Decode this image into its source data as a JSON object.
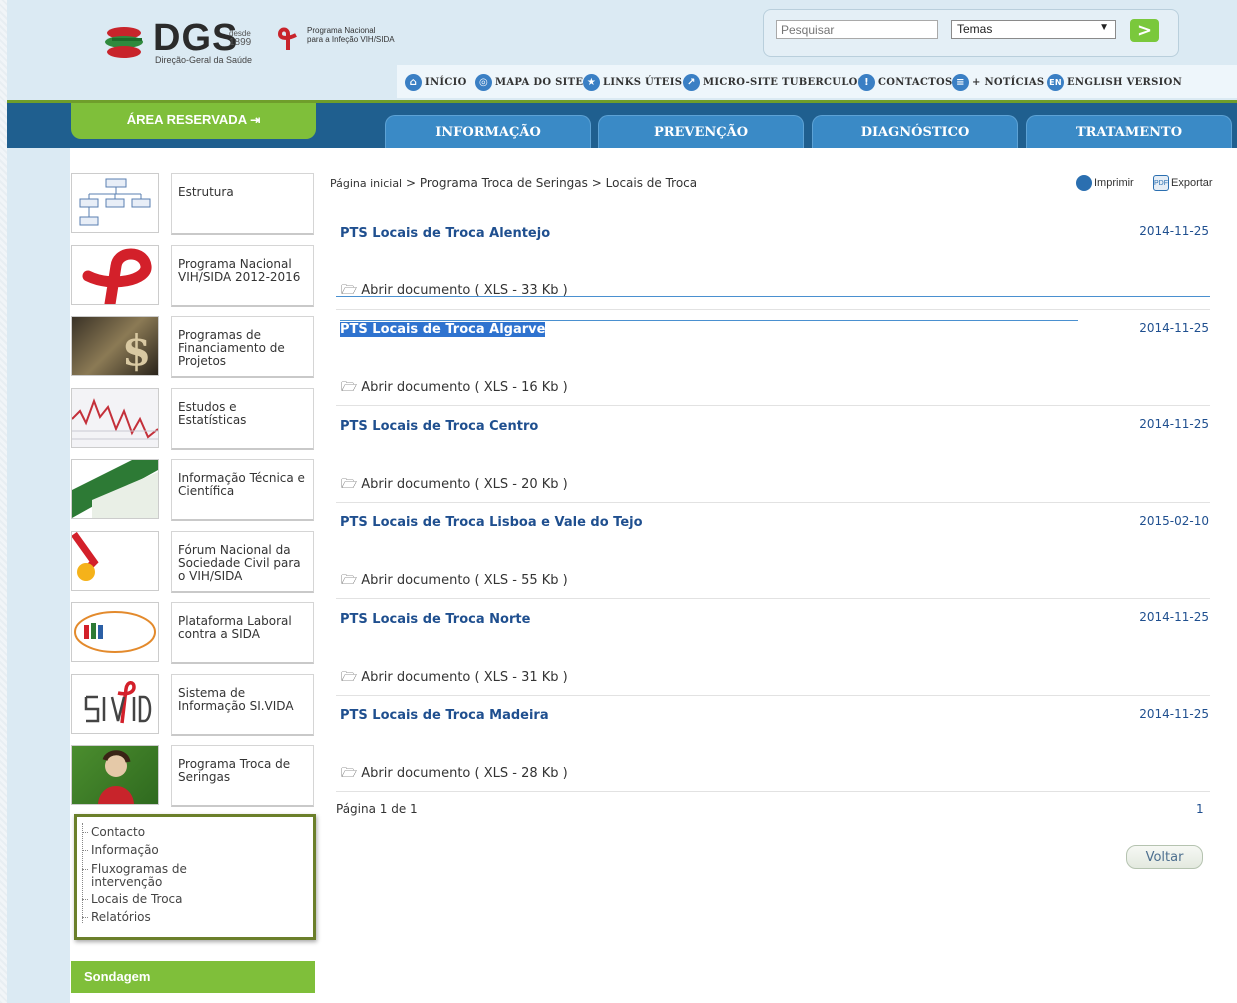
{
  "header": {
    "logo_text": "DGS",
    "logo_since_line1": "desde",
    "logo_since_line2": "1899",
    "logo_subtitle": "Direção-Geral da Saúde",
    "program_line1": "Programa Nacional",
    "program_line2": "para a Infeção VIH/SIDA"
  },
  "search": {
    "placeholder": "Pesquisar",
    "temas_label": "Temas",
    "go_label": ">"
  },
  "toplinks": [
    {
      "label": "INÍCIO",
      "icon": "home-icon"
    },
    {
      "label": "MAPA DO SITE",
      "icon": "sitemap-icon"
    },
    {
      "label": "LINKS ÚTEIS",
      "icon": "star-icon"
    },
    {
      "label": "MICRO-SITE TUBERCULOSE",
      "icon": "external-link-icon"
    },
    {
      "label": "CONTACTOS",
      "icon": "info-icon"
    },
    {
      "label": "+ NOTÍCIAS",
      "icon": "news-icon"
    },
    {
      "label": "ENGLISH VERSION",
      "icon": "en-flag-icon",
      "glyph": "EN"
    }
  ],
  "nav": {
    "area_reservada": "ÁREA RESERVADA",
    "tabs": [
      "INFORMAÇÃO",
      "PREVENÇÃO",
      "DIAGNÓSTICO",
      "TRATAMENTO"
    ]
  },
  "sidebar": {
    "tiles": [
      {
        "label": "Estrutura"
      },
      {
        "label": "Programa Nacional VIH/SIDA 2012-2016"
      },
      {
        "label": "Programas de Financiamento de Projetos"
      },
      {
        "label": "Estudos e Estatísticas"
      },
      {
        "label": "Informação Técnica e Científica"
      },
      {
        "label": "Fórum Nacional da Sociedade Civil para o VIH/SIDA"
      },
      {
        "label": "Plataforma Laboral contra a SIDA"
      },
      {
        "label": "Sistema de Informação SI.VIDA"
      },
      {
        "label": "Programa Troca de Seringas"
      }
    ],
    "tree": [
      "Contacto",
      "Informação",
      "Fluxogramas de intervenção",
      "Locais de Troca",
      "Relatórios"
    ],
    "sondagem": "Sondagem"
  },
  "breadcrumb": {
    "home": "Página inicial",
    "sep": ">",
    "level1": "Programa Troca de Seringas",
    "level2": "Locais de Troca"
  },
  "actions": {
    "print": "Imprimir",
    "export": "Exportar"
  },
  "documents": [
    {
      "title": "PTS Locais de Troca Alentejo",
      "date": "2014-11-25",
      "open": "Abrir documento ( XLS - 33 Kb )"
    },
    {
      "title": "PTS Locais de Troca Algarve",
      "date": "2014-11-25",
      "open": "Abrir documento ( XLS - 16 Kb )"
    },
    {
      "title": "PTS Locais de Troca Centro",
      "date": "2014-11-25",
      "open": "Abrir documento ( XLS - 20 Kb )"
    },
    {
      "title": "PTS Locais de Troca Lisboa e Vale do Tejo",
      "date": "2015-02-10",
      "open": "Abrir documento ( XLS - 55 Kb )"
    },
    {
      "title": "PTS Locais de Troca Norte",
      "date": "2014-11-25",
      "open": "Abrir documento ( XLS - 31 Kb )"
    },
    {
      "title": "PTS Locais de Troca Madeira",
      "date": "2014-11-25",
      "open": "Abrir documento ( XLS - 28 Kb )"
    }
  ],
  "pagination": {
    "info": "Página 1 de 1",
    "page": "1"
  },
  "voltar": "Voltar",
  "colors": {
    "accent_green": "#7fbf3a",
    "nav_blue": "#1f5f8f",
    "tab_blue": "#3a8ac6",
    "link_blue": "#1f4f8f"
  }
}
